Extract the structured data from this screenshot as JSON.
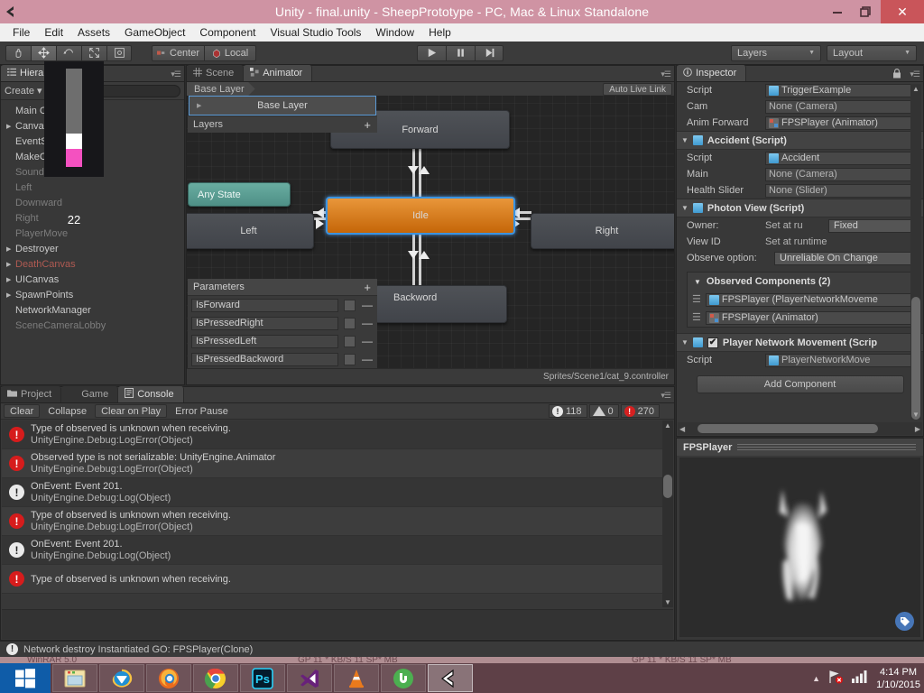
{
  "window": {
    "title": "Unity - final.unity - SheepPrototype - PC, Mac & Linux Standalone",
    "minimize": "—",
    "maximize": "❐",
    "close": "✕"
  },
  "menubar": {
    "items": [
      "File",
      "Edit",
      "Assets",
      "GameObject",
      "Component",
      "Visual Studio Tools",
      "Window",
      "Help"
    ]
  },
  "toolbar": {
    "transform_tools": [
      "hand-tool",
      "move-tool",
      "rotate-tool",
      "scale-tool",
      "rect-tool"
    ],
    "pivot_mode": "Center",
    "pivot_rotation": "Local",
    "play": "▶",
    "pause": "❙❙",
    "step": "▶❙",
    "layers": "Layers",
    "layout": "Layout",
    "caret": "▼"
  },
  "hierarchy": {
    "tab": "Hierarchy",
    "create_label": "Create",
    "create_caret": "▾",
    "items": [
      {
        "label": "Main Camera",
        "expandable": false,
        "style": "normal"
      },
      {
        "label": "Canvas",
        "expandable": true,
        "style": "normal"
      },
      {
        "label": "EventSystem",
        "expandable": false,
        "style": "normal"
      },
      {
        "label": "MakeCars",
        "expandable": false,
        "style": "normal"
      },
      {
        "label": "SoundCar",
        "expandable": false,
        "style": "dim"
      },
      {
        "label": "Left",
        "expandable": false,
        "style": "dim"
      },
      {
        "label": "Downward",
        "expandable": false,
        "style": "dim"
      },
      {
        "label": "Right",
        "expandable": false,
        "style": "dim"
      },
      {
        "label": "PlayerMove",
        "expandable": false,
        "style": "dim"
      },
      {
        "label": "Destroyer",
        "expandable": true,
        "style": "normal"
      },
      {
        "label": "DeathCanvas",
        "expandable": true,
        "style": "red"
      },
      {
        "label": "UICanvas",
        "expandable": true,
        "style": "normal"
      },
      {
        "label": "SpawnPoints",
        "expandable": true,
        "style": "normal"
      },
      {
        "label": "NetworkManager",
        "expandable": false,
        "style": "normal"
      },
      {
        "label": "SceneCameraLobby",
        "expandable": false,
        "style": "dim"
      }
    ]
  },
  "overlay_popup": {
    "value": "22"
  },
  "animator": {
    "tabs": [
      {
        "label": "Scene",
        "icon": "grid-icon",
        "active": false
      },
      {
        "label": "Animator",
        "icon": "animator-icon",
        "active": true
      }
    ],
    "breadcrumb": "Base Layer",
    "auto_live_link": "Auto Live Link",
    "layers_panel": {
      "selected_layer": "Base Layer",
      "header": "Layers",
      "add": "+",
      "fold": "▶"
    },
    "parameters_panel": {
      "header": "Parameters",
      "add": "+",
      "remove": "—",
      "rows": [
        {
          "name": "IsForward",
          "checked": false
        },
        {
          "name": "IsPressedRight",
          "checked": false
        },
        {
          "name": "IsPressedLeft",
          "checked": false
        },
        {
          "name": "IsPressedBackword",
          "checked": false
        }
      ]
    },
    "states": [
      {
        "name": "Forward",
        "type": "normal"
      },
      {
        "name": "Any State",
        "type": "any"
      },
      {
        "name": "Left",
        "type": "normal"
      },
      {
        "name": "Idle",
        "type": "default-selected"
      },
      {
        "name": "Right",
        "type": "normal"
      },
      {
        "name": "Backword",
        "type": "normal"
      }
    ],
    "status_path": "Sprites/Scene1/cat_9.controller"
  },
  "inspector": {
    "tab": "Inspector",
    "lock_icon": "lock-icon",
    "top_rows": [
      {
        "label": "Script",
        "value": "TriggerExample",
        "icon": "cs-script-icon"
      },
      {
        "label": "Cam",
        "value": "None (Camera)",
        "icon": "none"
      },
      {
        "label": "Anim Forward",
        "value": "FPSPlayer (Animator)",
        "icon": "animator-icon"
      }
    ],
    "components": [
      {
        "title": "Accident (Script)",
        "icon": "cs-script-icon",
        "rows": [
          {
            "label": "Script",
            "value": "Accident",
            "icon": "cs-script-icon"
          },
          {
            "label": "Main",
            "value": "None (Camera)",
            "icon": "none"
          },
          {
            "label": "Health Slider",
            "value": "None (Slider)",
            "icon": "none"
          }
        ]
      }
    ],
    "photon": {
      "title": "Photon View (Script)",
      "icon": "cs-script-icon",
      "owner_label": "Owner:",
      "owner_value": "Set at ru",
      "owner_dropdown": "Fixed",
      "view_id_label": "View ID",
      "view_id_value": "Set at runtime",
      "observe_label": "Observe option:",
      "observe_value": "Unreliable On Change",
      "observed_header": "Observed Components (2)",
      "observed_fold": "▼",
      "observed": [
        {
          "value": "FPSPlayer (PlayerNetworkMoveme",
          "icon": "cs-script-icon"
        },
        {
          "value": "FPSPlayer (Animator)",
          "icon": "animator-icon"
        }
      ]
    },
    "player_network_movement": {
      "title": "Player Network Movement (Scrip",
      "icon": "cs-script-icon",
      "enabled": true,
      "check": "✔",
      "rows": [
        {
          "label": "Script",
          "value": "PlayerNetworkMove",
          "icon": "cs-script-icon"
        }
      ]
    },
    "add_component": "Add Component"
  },
  "preview": {
    "title": "FPSPlayer",
    "tag_icon": "tag-icon"
  },
  "console": {
    "tabs": [
      {
        "label": "Project",
        "icon": "folder-icon",
        "active": false
      },
      {
        "label": "Game",
        "icon": "game-icon",
        "active": false
      },
      {
        "label": "Console",
        "icon": "console-icon",
        "active": true
      }
    ],
    "buttons": [
      "Clear",
      "Collapse",
      "Clear on Play",
      "Error Pause"
    ],
    "counters": [
      {
        "type": "info",
        "count": "118"
      },
      {
        "type": "warn",
        "count": "0"
      },
      {
        "type": "error",
        "count": "270"
      }
    ],
    "logs": [
      {
        "type": "error",
        "line1": "Type of observed is unknown when receiving.",
        "line2": "UnityEngine.Debug:LogError(Object)"
      },
      {
        "type": "error",
        "line1": "Observed type is not serializable: UnityEngine.Animator",
        "line2": "UnityEngine.Debug:LogError(Object)"
      },
      {
        "type": "info",
        "line1": "OnEvent: Event 201.",
        "line2": "UnityEngine.Debug:Log(Object)"
      },
      {
        "type": "error",
        "line1": "Type of observed is unknown when receiving.",
        "line2": "UnityEngine.Debug:LogError(Object)"
      },
      {
        "type": "info",
        "line1": "OnEvent: Event 201.",
        "line2": "UnityEngine.Debug:Log(Object)"
      },
      {
        "type": "error",
        "line1": "Type of observed is unknown when receiving.",
        "line2": ""
      }
    ]
  },
  "statusbar": {
    "icon": "info-icon",
    "message": "Network destroy Instantiated GO: FPSPlayer(Clone)"
  },
  "bleed_text": {
    "left": "WinRAR 5.0",
    "mid": "GP 11 * KB/S 11 SP* MB",
    "right": "GP 11 * KB/S 11 SP* MB"
  },
  "taskbar": {
    "start": "windows-logo",
    "items": [
      {
        "name": "file-explorer",
        "active": false
      },
      {
        "name": "internet-explorer",
        "active": false
      },
      {
        "name": "firefox",
        "active": false
      },
      {
        "name": "chrome",
        "active": false
      },
      {
        "name": "photoshop",
        "active": false
      },
      {
        "name": "visual-studio",
        "active": false
      },
      {
        "name": "vlc",
        "active": false
      },
      {
        "name": "utorrent",
        "active": false
      },
      {
        "name": "unity",
        "active": true
      }
    ],
    "tray": {
      "show_hidden": "▲",
      "network_icon": "network-error-icon",
      "signal_icon": "signal-icon"
    },
    "clock": {
      "time": "4:14 PM",
      "date": "1/10/2015"
    }
  },
  "colors": {
    "title_bar": "#cf93a3",
    "close_button": "#c9555a",
    "editor_bg": "#383838",
    "graph_bg": "#252525",
    "idle_node": "#d07c18",
    "idle_node_border": "#3b93e0",
    "any_state_node": "#5a9a90",
    "error_red": "#d61c1c",
    "taskbar": "#5e4047",
    "start_button": "#0f5ca8"
  }
}
